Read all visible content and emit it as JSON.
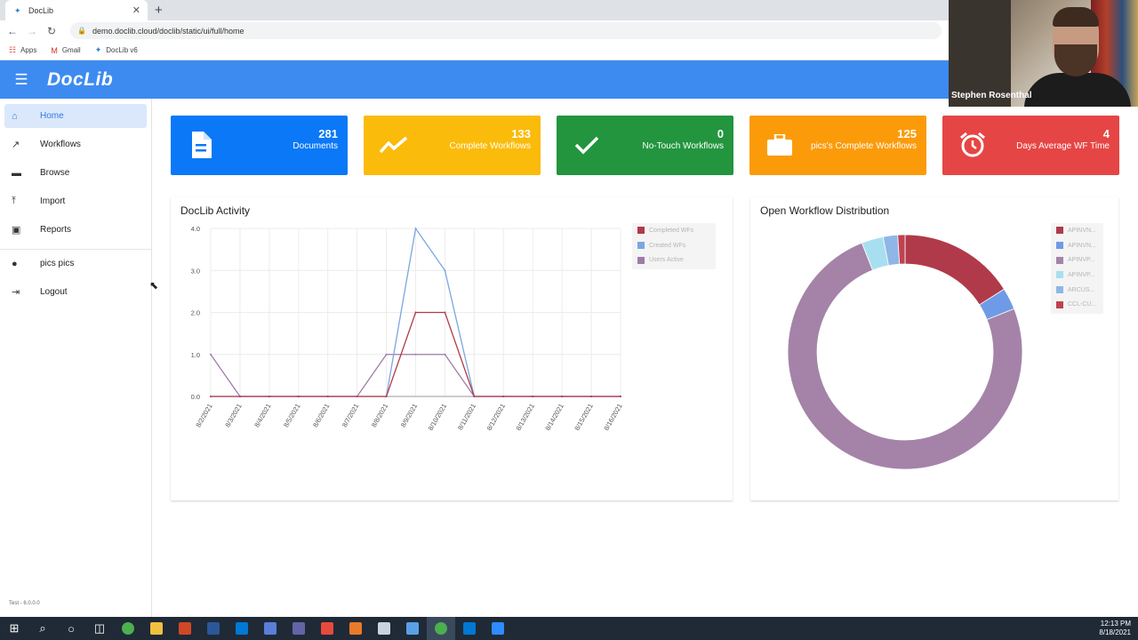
{
  "browser": {
    "tab_title": "DocLib",
    "new_tab": "+",
    "url": "demo.doclib.cloud/doclib/static/ui/full/home",
    "bookmarks": [
      {
        "label": "Apps",
        "icon": "apps-grid-icon"
      },
      {
        "label": "Gmail",
        "icon": "gmail-icon"
      },
      {
        "label": "DocLib v6",
        "icon": "doclib-icon"
      }
    ]
  },
  "app": {
    "logo": "DocLib"
  },
  "webcam": {
    "name": "Stephen Rosenthal"
  },
  "sidebar": {
    "items": [
      {
        "label": "Home",
        "icon": "home-icon",
        "active": true
      },
      {
        "label": "Workflows",
        "icon": "trending-icon"
      },
      {
        "label": "Browse",
        "icon": "folder-icon"
      },
      {
        "label": "Import",
        "icon": "upload-icon"
      },
      {
        "label": "Reports",
        "icon": "report-search-icon"
      },
      {
        "label": "pics pics",
        "icon": "user-icon"
      },
      {
        "label": "Logout",
        "icon": "logout-icon"
      }
    ],
    "version": "Test - 6.0.0.0"
  },
  "stats": [
    {
      "value": "281",
      "label": "Documents",
      "color": "#0a78f7",
      "icon": "document-icon"
    },
    {
      "value": "133",
      "label": "Complete Workflows",
      "color": "#fbbb0a",
      "icon": "trend-line-icon"
    },
    {
      "value": "0",
      "label": "No-Touch Workflows",
      "color": "#22953e",
      "icon": "checkmark-icon"
    },
    {
      "value": "125",
      "label": "pics's Complete Workflows",
      "color": "#fb9b0a",
      "icon": "briefcase-icon"
    },
    {
      "value": "4",
      "label": "Days Average WF Time",
      "color": "#e64545",
      "icon": "alarm-clock-icon"
    }
  ],
  "activity": {
    "title": "DocLib Activity",
    "chart_data": {
      "type": "line",
      "x": [
        "8/2/2021",
        "8/3/2021",
        "8/4/2021",
        "8/5/2021",
        "8/6/2021",
        "8/7/2021",
        "8/8/2021",
        "8/9/2021",
        "8/10/2021",
        "8/11/2021",
        "8/12/2021",
        "8/13/2021",
        "8/14/2021",
        "8/15/2021",
        "8/16/2021"
      ],
      "ylim": [
        0,
        4
      ],
      "yticks": [
        "0.0",
        "1.0",
        "2.0",
        "3.0",
        "4.0"
      ],
      "grid": true,
      "legend_position": "top-right",
      "series": [
        {
          "name": "Completed WFs",
          "color": "#b03a4a",
          "values": [
            0,
            0,
            0,
            0,
            0,
            0,
            0,
            2,
            2,
            0,
            0,
            0,
            0,
            0,
            0
          ]
        },
        {
          "name": "Created WFs",
          "color": "#7aa7e0",
          "values": [
            0,
            0,
            0,
            0,
            0,
            0,
            0,
            4,
            3,
            0,
            0,
            0,
            0,
            0,
            0
          ]
        },
        {
          "name": "Users Active",
          "color": "#a07ba8",
          "values": [
            1,
            0,
            0,
            0,
            0,
            0,
            1,
            1,
            1,
            0,
            0,
            0,
            0,
            0,
            0
          ]
        }
      ]
    }
  },
  "distribution": {
    "title": "Open Workflow Distribution",
    "chart_data": {
      "type": "pie",
      "legend_position": "top-right",
      "labels": [
        "APINVN...",
        "APINVN...",
        "APINVP...",
        "APINVP...",
        "ARCUS...",
        "CCL-CU..."
      ],
      "colors": [
        "#b03a4a",
        "#6f9be6",
        "#a583a9",
        "#a8dff0",
        "#8fb6e6",
        "#c0424f"
      ],
      "values": [
        16,
        3,
        75,
        3,
        2,
        1
      ]
    }
  },
  "taskbar": {
    "time": "12:13 PM",
    "date": "8/18/2021",
    "apps": [
      {
        "icon": "windows-start-icon",
        "color": "#ffffff"
      },
      {
        "icon": "search-icon",
        "color": "#ffffff"
      },
      {
        "icon": "cortana-icon",
        "color": "#ffffff"
      },
      {
        "icon": "task-view-icon",
        "color": "#ffffff"
      },
      {
        "icon": "chrome-icon",
        "color": "#4caf50"
      },
      {
        "icon": "file-explorer-icon",
        "color": "#f0c040"
      },
      {
        "icon": "powerpoint-icon",
        "color": "#d24726"
      },
      {
        "icon": "word-icon",
        "color": "#2b579a"
      },
      {
        "icon": "outlook-icon",
        "color": "#0078d4"
      },
      {
        "icon": "app-icon",
        "color": "#5a7fd6"
      },
      {
        "icon": "teams-icon",
        "color": "#6264a7"
      },
      {
        "icon": "app-icon",
        "color": "#e84a3c"
      },
      {
        "icon": "app-icon",
        "color": "#e87a2a"
      },
      {
        "icon": "app-icon",
        "color": "#c9d3dd"
      },
      {
        "icon": "app-icon",
        "color": "#5aa0e6"
      },
      {
        "icon": "chrome-icon",
        "color": "#4caf50"
      },
      {
        "icon": "outlook-icon",
        "color": "#0078d4"
      },
      {
        "icon": "zoom-icon",
        "color": "#2d8cff"
      }
    ]
  }
}
